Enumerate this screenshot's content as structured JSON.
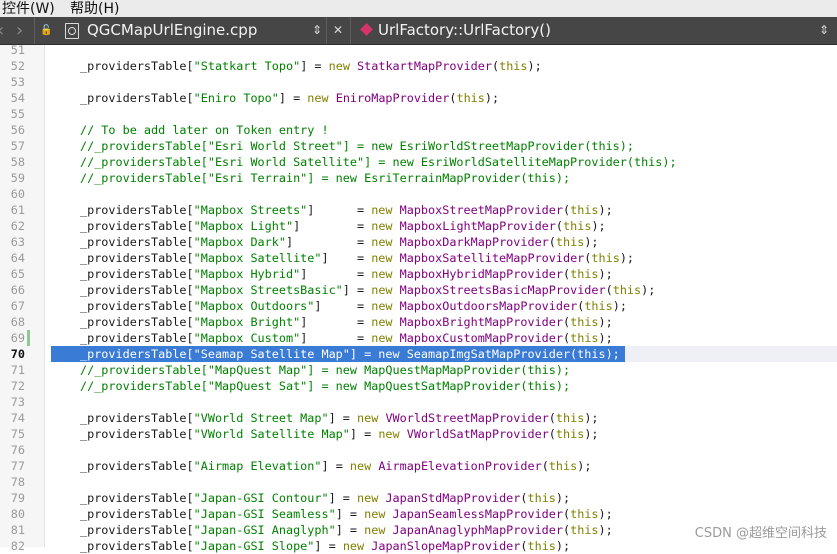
{
  "menu": {
    "controls": "控件(W)",
    "help": "帮助(H)"
  },
  "toolbar": {
    "file_name": "QGCMapUrlEngine.cpp",
    "symbol_name": "UrlFactory::UrlFactory()",
    "back_glyph": "‹",
    "forward_glyph": "›",
    "lock_glyph": "🔓",
    "updown_glyph": "⇕",
    "close_glyph": "✕"
  },
  "editor": {
    "current_line": 70,
    "lines": [
      {
        "n": "51",
        "code": []
      },
      {
        "n": "52",
        "code": [
          [
            "p",
            "_providersTable["
          ],
          [
            "s",
            "\"Statkart Topo\""
          ],
          [
            "p",
            "] = "
          ],
          [
            "k",
            "new "
          ],
          [
            "t",
            "StatkartMapProvider"
          ],
          [
            "p",
            "("
          ],
          [
            "k",
            "this"
          ],
          [
            "p",
            ");"
          ]
        ]
      },
      {
        "n": "53",
        "code": []
      },
      {
        "n": "54",
        "code": [
          [
            "p",
            "_providersTable["
          ],
          [
            "s",
            "\"Eniro Topo\""
          ],
          [
            "p",
            "] = "
          ],
          [
            "k",
            "new "
          ],
          [
            "t",
            "EniroMapProvider"
          ],
          [
            "p",
            "("
          ],
          [
            "k",
            "this"
          ],
          [
            "p",
            ");"
          ]
        ]
      },
      {
        "n": "55",
        "code": []
      },
      {
        "n": "56",
        "code": [
          [
            "c",
            "// To be add later on Token entry !"
          ]
        ]
      },
      {
        "n": "57",
        "code": [
          [
            "c",
            "//_providersTable[\"Esri World Street\"] = new EsriWorldStreetMapProvider(this);"
          ]
        ]
      },
      {
        "n": "58",
        "code": [
          [
            "c",
            "//_providersTable[\"Esri World Satellite\"] = new EsriWorldSatelliteMapProvider(this);"
          ]
        ]
      },
      {
        "n": "59",
        "code": [
          [
            "c",
            "//_providersTable[\"Esri Terrain\"] = new EsriTerrainMapProvider(this);"
          ]
        ]
      },
      {
        "n": "60",
        "code": []
      },
      {
        "n": "61",
        "code": [
          [
            "p",
            "_providersTable["
          ],
          [
            "s",
            "\"Mapbox Streets\""
          ],
          [
            "p",
            "]      = "
          ],
          [
            "k",
            "new "
          ],
          [
            "t",
            "MapboxStreetMapProvider"
          ],
          [
            "p",
            "("
          ],
          [
            "k",
            "this"
          ],
          [
            "p",
            ");"
          ]
        ]
      },
      {
        "n": "62",
        "code": [
          [
            "p",
            "_providersTable["
          ],
          [
            "s",
            "\"Mapbox Light\""
          ],
          [
            "p",
            "]        = "
          ],
          [
            "k",
            "new "
          ],
          [
            "t",
            "MapboxLightMapProvider"
          ],
          [
            "p",
            "("
          ],
          [
            "k",
            "this"
          ],
          [
            "p",
            ");"
          ]
        ]
      },
      {
        "n": "63",
        "code": [
          [
            "p",
            "_providersTable["
          ],
          [
            "s",
            "\"Mapbox Dark\""
          ],
          [
            "p",
            "]         = "
          ],
          [
            "k",
            "new "
          ],
          [
            "t",
            "MapboxDarkMapProvider"
          ],
          [
            "p",
            "("
          ],
          [
            "k",
            "this"
          ],
          [
            "p",
            ");"
          ]
        ]
      },
      {
        "n": "64",
        "code": [
          [
            "p",
            "_providersTable["
          ],
          [
            "s",
            "\"Mapbox Satellite\""
          ],
          [
            "p",
            "]    = "
          ],
          [
            "k",
            "new "
          ],
          [
            "t",
            "MapboxSatelliteMapProvider"
          ],
          [
            "p",
            "("
          ],
          [
            "k",
            "this"
          ],
          [
            "p",
            ");"
          ]
        ]
      },
      {
        "n": "65",
        "code": [
          [
            "p",
            "_providersTable["
          ],
          [
            "s",
            "\"Mapbox Hybrid\""
          ],
          [
            "p",
            "]       = "
          ],
          [
            "k",
            "new "
          ],
          [
            "t",
            "MapboxHybridMapProvider"
          ],
          [
            "p",
            "("
          ],
          [
            "k",
            "this"
          ],
          [
            "p",
            ");"
          ]
        ]
      },
      {
        "n": "66",
        "code": [
          [
            "p",
            "_providersTable["
          ],
          [
            "s",
            "\"Mapbox StreetsBasic\""
          ],
          [
            "p",
            "] = "
          ],
          [
            "k",
            "new "
          ],
          [
            "t",
            "MapboxStreetsBasicMapProvider"
          ],
          [
            "p",
            "("
          ],
          [
            "k",
            "this"
          ],
          [
            "p",
            ");"
          ]
        ]
      },
      {
        "n": "67",
        "code": [
          [
            "p",
            "_providersTable["
          ],
          [
            "s",
            "\"Mapbox Outdoors\""
          ],
          [
            "p",
            "]     = "
          ],
          [
            "k",
            "new "
          ],
          [
            "t",
            "MapboxOutdoorsMapProvider"
          ],
          [
            "p",
            "("
          ],
          [
            "k",
            "this"
          ],
          [
            "p",
            ");"
          ]
        ]
      },
      {
        "n": "68",
        "code": [
          [
            "p",
            "_providersTable["
          ],
          [
            "s",
            "\"Mapbox Bright\""
          ],
          [
            "p",
            "]       = "
          ],
          [
            "k",
            "new "
          ],
          [
            "t",
            "MapboxBrightMapProvider"
          ],
          [
            "p",
            "("
          ],
          [
            "k",
            "this"
          ],
          [
            "p",
            ");"
          ]
        ]
      },
      {
        "n": "69",
        "code": [
          [
            "p",
            "_providersTable["
          ],
          [
            "s",
            "\"Mapbox Custom\""
          ],
          [
            "p",
            "]       = "
          ],
          [
            "k",
            "new "
          ],
          [
            "t",
            "MapboxCustomMapProvider"
          ],
          [
            "p",
            "("
          ],
          [
            "k",
            "this"
          ],
          [
            "p",
            ");"
          ]
        ]
      },
      {
        "n": "70",
        "selected": true,
        "code": [
          [
            "p",
            "_providersTable[\"Seamap Satellite Map\"] = new SeamapImgSatMapProvider(this);"
          ]
        ]
      },
      {
        "n": "71",
        "code": [
          [
            "c",
            "//_providersTable[\"MapQuest Map\"] = new MapQuestMapMapProvider(this);"
          ]
        ]
      },
      {
        "n": "72",
        "code": [
          [
            "c",
            "//_providersTable[\"MapQuest Sat\"] = new MapQuestSatMapProvider(this);"
          ]
        ]
      },
      {
        "n": "73",
        "code": []
      },
      {
        "n": "74",
        "code": [
          [
            "p",
            "_providersTable["
          ],
          [
            "s",
            "\"VWorld Street Map\""
          ],
          [
            "p",
            "] = "
          ],
          [
            "k",
            "new "
          ],
          [
            "t",
            "VWorldStreetMapProvider"
          ],
          [
            "p",
            "("
          ],
          [
            "k",
            "this"
          ],
          [
            "p",
            ");"
          ]
        ]
      },
      {
        "n": "75",
        "code": [
          [
            "p",
            "_providersTable["
          ],
          [
            "s",
            "\"VWorld Satellite Map\""
          ],
          [
            "p",
            "] = "
          ],
          [
            "k",
            "new "
          ],
          [
            "t",
            "VWorldSatMapProvider"
          ],
          [
            "p",
            "("
          ],
          [
            "k",
            "this"
          ],
          [
            "p",
            ");"
          ]
        ]
      },
      {
        "n": "76",
        "code": []
      },
      {
        "n": "77",
        "code": [
          [
            "p",
            "_providersTable["
          ],
          [
            "s",
            "\"Airmap Elevation\""
          ],
          [
            "p",
            "] = "
          ],
          [
            "k",
            "new "
          ],
          [
            "t",
            "AirmapElevationProvider"
          ],
          [
            "p",
            "("
          ],
          [
            "k",
            "this"
          ],
          [
            "p",
            ");"
          ]
        ]
      },
      {
        "n": "78",
        "code": []
      },
      {
        "n": "79",
        "code": [
          [
            "p",
            "_providersTable["
          ],
          [
            "s",
            "\"Japan-GSI Contour\""
          ],
          [
            "p",
            "] = "
          ],
          [
            "k",
            "new "
          ],
          [
            "t",
            "JapanStdMapProvider"
          ],
          [
            "p",
            "("
          ],
          [
            "k",
            "this"
          ],
          [
            "p",
            ");"
          ]
        ]
      },
      {
        "n": "80",
        "code": [
          [
            "p",
            "_providersTable["
          ],
          [
            "s",
            "\"Japan-GSI Seamless\""
          ],
          [
            "p",
            "] = "
          ],
          [
            "k",
            "new "
          ],
          [
            "t",
            "JapanSeamlessMapProvider"
          ],
          [
            "p",
            "("
          ],
          [
            "k",
            "this"
          ],
          [
            "p",
            ");"
          ]
        ]
      },
      {
        "n": "81",
        "code": [
          [
            "p",
            "_providersTable["
          ],
          [
            "s",
            "\"Japan-GSI Anaglyph\""
          ],
          [
            "p",
            "] = "
          ],
          [
            "k",
            "new "
          ],
          [
            "t",
            "JapanAnaglyphMapProvider"
          ],
          [
            "p",
            "("
          ],
          [
            "k",
            "this"
          ],
          [
            "p",
            ");"
          ]
        ]
      },
      {
        "n": "82",
        "code": [
          [
            "p",
            "_providersTable["
          ],
          [
            "s",
            "\"Japan-GSI Slope\""
          ],
          [
            "p",
            "] = "
          ],
          [
            "k",
            "new "
          ],
          [
            "t",
            "JapanSlopeMapProvider"
          ],
          [
            "p",
            "("
          ],
          [
            "k",
            "this"
          ],
          [
            "p",
            ");"
          ]
        ]
      }
    ]
  },
  "watermark": "CSDN @超维空间科技"
}
